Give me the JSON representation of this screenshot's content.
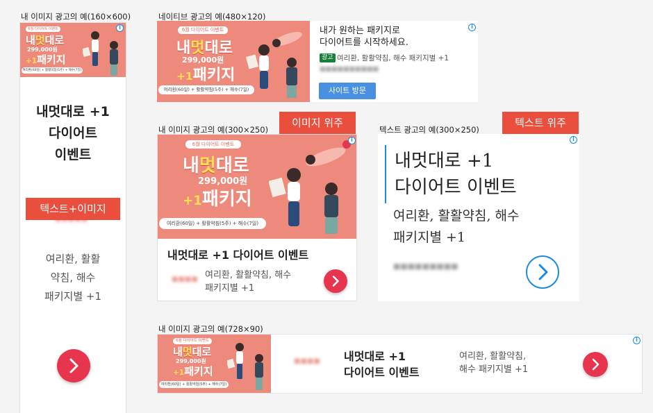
{
  "captions": {
    "ad160": "내 이미지 광고의 예(160×600)",
    "native": "네이티브 광고의 예(480×120)",
    "ad300img": "내 이미지 광고의 예(300×250)",
    "ad300txt": "텍스트 광고의 예(300×250)",
    "ad728": "내 이미지 광고의 예(728×90)"
  },
  "labels": {
    "image_focus": "이미지 위주",
    "text_focus": "텍스트 위주",
    "text_plus_image": "텍스트+이미지"
  },
  "banner": {
    "tag": "6월 다이어트 이벤트",
    "title_a": "내",
    "title_hi": "멋",
    "title_b": "대로",
    "price": "299,000원",
    "plus": "+1",
    "sub": "패키지",
    "foot": "여리환(60일) + 활활약침(5주) + 해수(7일)"
  },
  "ad": {
    "headline": "내멋대로 +1 다이어트 이벤트",
    "headline_line1": "내멋대로 +1",
    "headline_line2": "다이어트 이벤트",
    "headline_l1_160": "내멋대로 +1",
    "headline_l2_160": "다이어트",
    "headline_l3_160": "이벤트",
    "desc": "여리환, 활활약침, 해수 패키지별 +1",
    "desc_l1": "여리환, 활활약침, 해수",
    "desc_l2": "패키지별 +1",
    "desc_160_l1": "여리환, 활활",
    "desc_160_l2": "약침, 해수",
    "desc_160_l3": "패키지별 +1",
    "desc_728_l1": "여리환, 활활약침,",
    "desc_728_l2": "해수 패키지별 +1",
    "txt_l1": "내멋대로 +1",
    "txt_l2": "다이어트 이벤트",
    "txt_desc_l1": "여리환, 활활약침, 해수",
    "txt_desc_l2": "패키지별 +1"
  },
  "native": {
    "headline_l1": "내가 원하는 패키지로",
    "headline_l2": "다이어트를 시작하세요.",
    "ad_badge": "광고",
    "desc": "여리환, 활활약침, 해수 패키지별 +1",
    "visit_button": "사이트 방문"
  },
  "info_glyph": "i",
  "colors": {
    "banner_bg": "#ee8a7c",
    "label_red": "#ea4f3d",
    "go_button": "#e8354f",
    "visit_button": "#4a90e2",
    "ad_badge": "#188038",
    "accent_blue": "#1a8cd8"
  }
}
